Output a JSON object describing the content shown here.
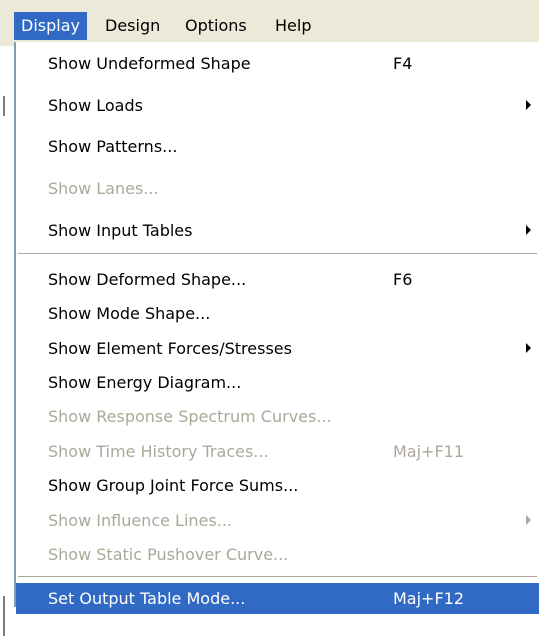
{
  "menubar": {
    "items": [
      {
        "label": "Display",
        "active": true
      },
      {
        "label": "Design",
        "active": false
      },
      {
        "label": "Options",
        "active": false
      },
      {
        "label": "Help",
        "active": false
      }
    ]
  },
  "menu": {
    "items": [
      {
        "label": "Show Undeformed Shape",
        "shortcut": "F4",
        "enabled": true,
        "submenu": false
      },
      {
        "label": "Show Loads",
        "shortcut": "",
        "enabled": true,
        "submenu": true
      },
      {
        "label": "Show Patterns...",
        "shortcut": "",
        "enabled": true,
        "submenu": false
      },
      {
        "label": "Show Lanes...",
        "shortcut": "",
        "enabled": false,
        "submenu": false
      },
      {
        "label": "Show Input Tables",
        "shortcut": "",
        "enabled": true,
        "submenu": true
      },
      {
        "label": "Show Deformed Shape...",
        "shortcut": "F6",
        "enabled": true,
        "submenu": false
      },
      {
        "label": "Show Mode Shape...",
        "shortcut": "",
        "enabled": true,
        "submenu": false
      },
      {
        "label": "Show Element Forces/Stresses",
        "shortcut": "",
        "enabled": true,
        "submenu": true
      },
      {
        "label": "Show Energy Diagram...",
        "shortcut": "",
        "enabled": true,
        "submenu": false
      },
      {
        "label": "Show Response Spectrum Curves...",
        "shortcut": "",
        "enabled": false,
        "submenu": false
      },
      {
        "label": "Show Time History Traces...",
        "shortcut": "Maj+F11",
        "enabled": false,
        "submenu": false
      },
      {
        "label": "Show Group Joint Force Sums...",
        "shortcut": "",
        "enabled": true,
        "submenu": false
      },
      {
        "label": "Show Influence Lines...",
        "shortcut": "",
        "enabled": false,
        "submenu": true
      },
      {
        "label": "Show Static Pushover Curve...",
        "shortcut": "",
        "enabled": false,
        "submenu": false
      },
      {
        "label": "Set Output Table Mode...",
        "shortcut": "Maj+F12",
        "enabled": true,
        "submenu": false,
        "selected": true
      }
    ]
  },
  "colors": {
    "highlight": "#316ac5",
    "menubar_bg": "#ece9d8",
    "disabled_text": "#aca899"
  },
  "icons": {
    "submenu": "submenu-arrow-icon"
  }
}
